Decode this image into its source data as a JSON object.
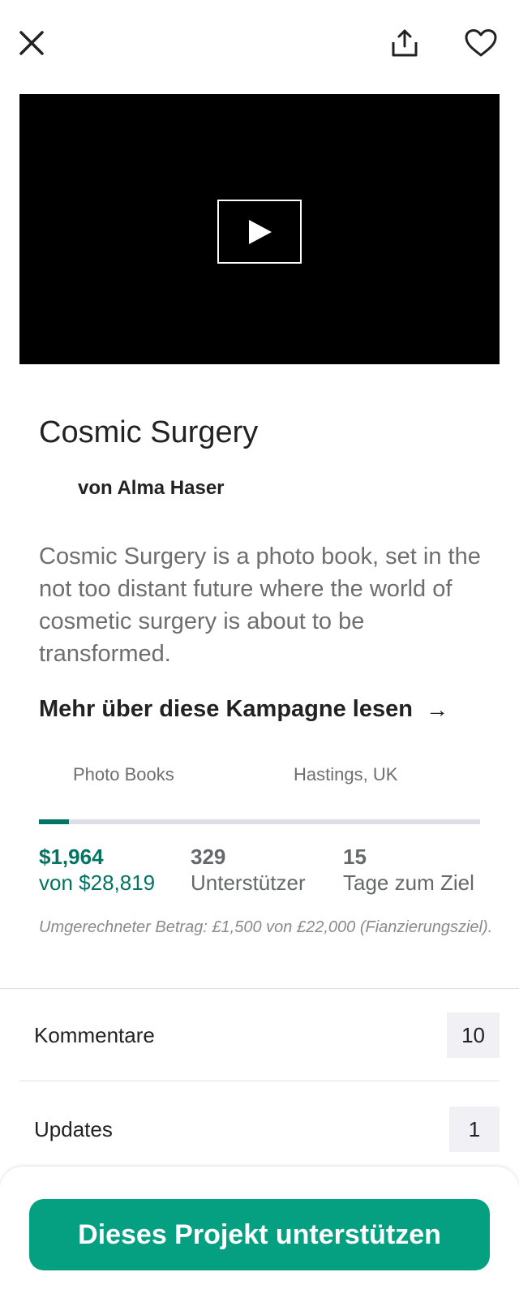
{
  "header": {
    "close_icon": "close-icon",
    "share_icon": "share-icon",
    "favorite_icon": "heart-icon"
  },
  "video": {
    "play_icon": "play-icon"
  },
  "project": {
    "title": "Cosmic Surgery",
    "author": "von Alma Haser",
    "blurb": "Cosmic Surgery is a photo book, set in the not too distant future where the world of cosmetic surgery is about to be transformed.",
    "read_more": "Mehr über diese Kampagne lesen",
    "read_more_arrow": "→",
    "category": "Photo Books",
    "location": "Hastings, UK"
  },
  "funding": {
    "progress_fraction": 0.068,
    "pledged": "$1,964",
    "goal": "von $28,819",
    "backers_count": "329",
    "backers_label": "Unterstützer",
    "days_count": "15",
    "days_label": "Tage zum Ziel",
    "converted_note": "Umgerechneter Betrag: £1,500 von £22,000 (Fianzierungsziel)."
  },
  "sections": {
    "comments_label": "Kommentare",
    "comments_count": "10",
    "updates_label": "Updates",
    "updates_count": "1"
  },
  "cta": {
    "label": "Dieses Projekt unterstützen"
  },
  "colors": {
    "accent_green": "#05a081",
    "progress_green": "#037362",
    "track_gray": "#dcdde6"
  }
}
